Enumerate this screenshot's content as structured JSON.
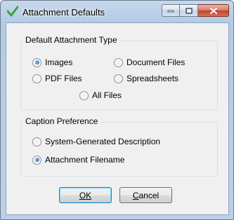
{
  "window": {
    "title": "Attachment Defaults"
  },
  "attachment_type": {
    "label": "Default Attachment Type",
    "options": [
      "Images",
      "Document Files",
      "PDF Files",
      "Spreadsheets",
      "All Files"
    ],
    "selected": "Images"
  },
  "caption_preference": {
    "label": "Caption Preference",
    "options": [
      "System-Generated Description",
      "Attachment Filename"
    ],
    "selected": "Attachment Filename"
  },
  "buttons": {
    "ok": "OK",
    "cancel": "Cancel"
  },
  "colors": {
    "checkmark": "#3aa33a",
    "close_button": "#c2402b"
  }
}
